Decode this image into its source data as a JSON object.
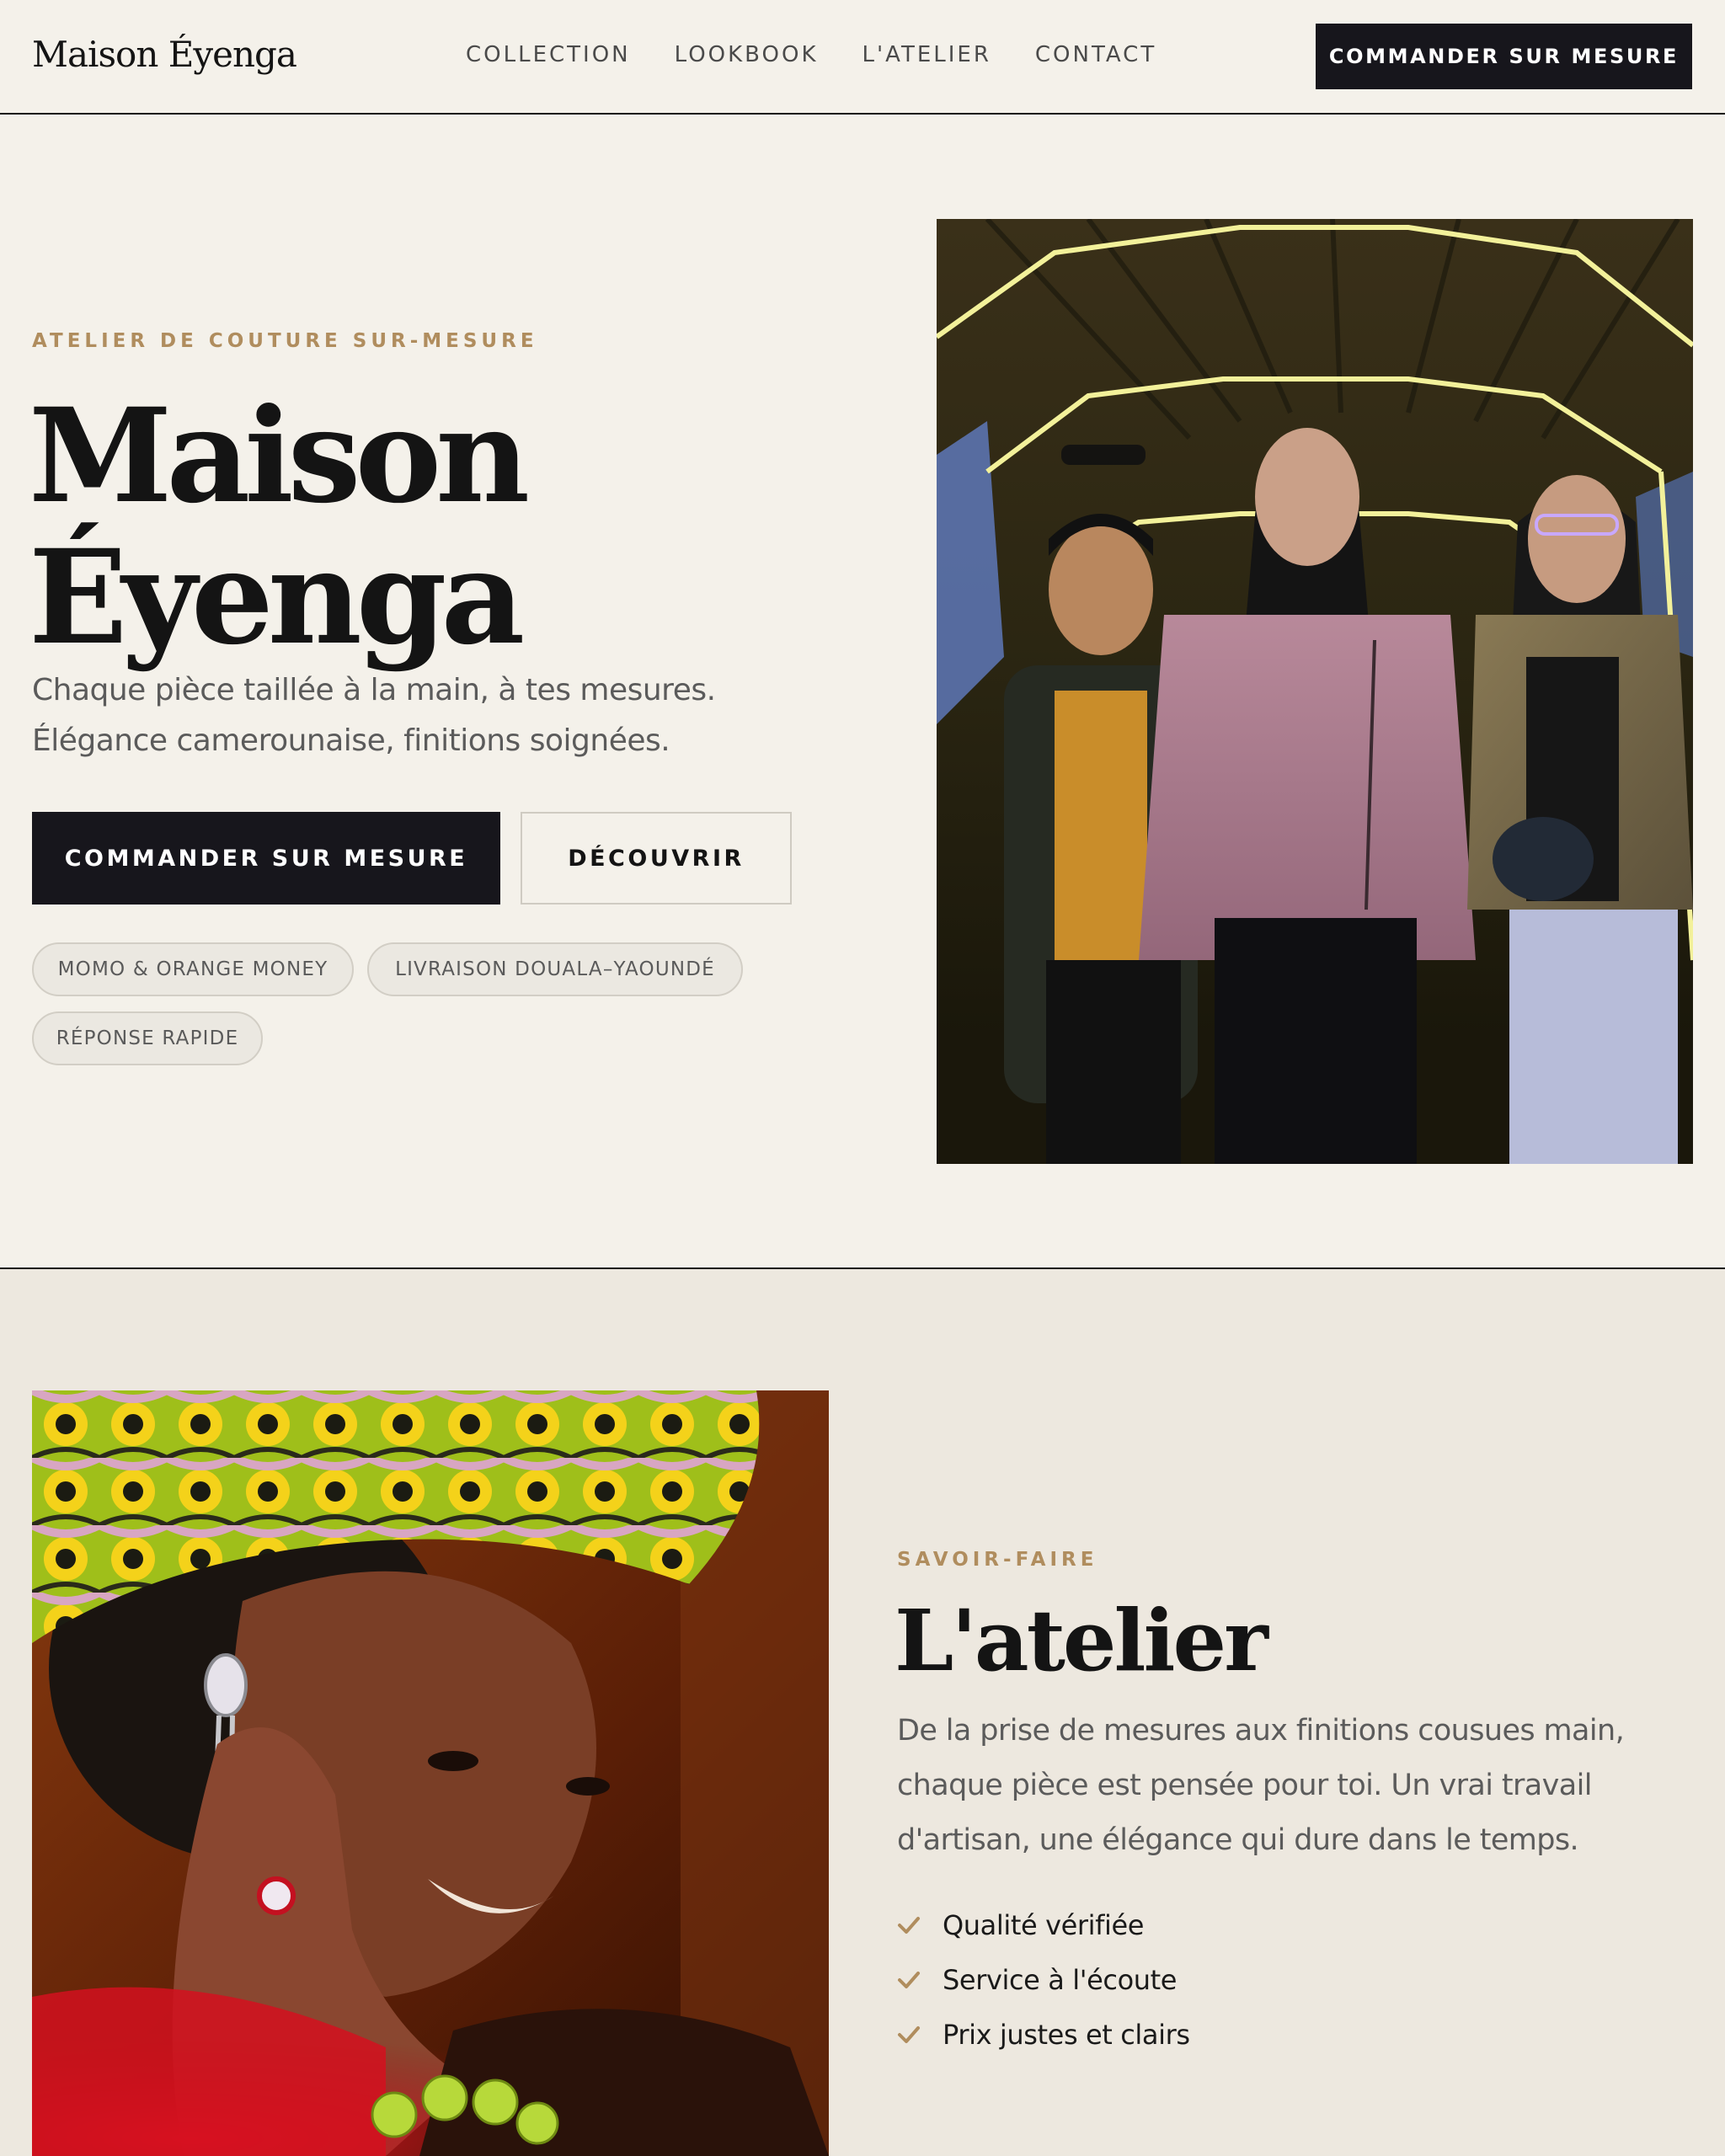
{
  "header": {
    "logo": "Maison Éyenga",
    "nav": [
      "COLLECTION",
      "LOOKBOOK",
      "L'ATELIER",
      "CONTACT"
    ],
    "cta": "COMMANDER SUR MESURE"
  },
  "hero": {
    "eyebrow": "ATELIER DE COUTURE SUR-MESURE",
    "title_line1": "Maison",
    "title_line2": "Éyenga",
    "subtitle_line1": "Chaque pièce taillée à la main, à tes mesures.",
    "subtitle_line2": "Élégance camerounaise, finitions soignées.",
    "primary_button": "COMMANDER SUR MESURE",
    "secondary_button": "DÉCOUVRIR",
    "chips": [
      "MOMO & ORANGE MONEY",
      "LIVRAISON DOUALA–YAOUNDÉ",
      "RÉPONSE RAPIDE"
    ]
  },
  "atelier": {
    "eyebrow": "SAVOIR-FAIRE",
    "title": "L'atelier",
    "text_line1": "De la prise de mesures aux finitions cousues main,",
    "text_line2": "chaque pièce est pensée pour toi. Un vrai travail",
    "text_line3": "d'artisan, une élégance qui dure dans le temps.",
    "features": [
      "Qualité vérifiée",
      "Service à l'écoute",
      "Prix justes et clairs"
    ]
  },
  "colors": {
    "background": "#f4f1ea",
    "section_background": "#ede8df",
    "ink": "#141414",
    "accent_gold": "#b08d5e",
    "button_dark": "#17161c"
  },
  "icons": [
    "check-icon"
  ]
}
